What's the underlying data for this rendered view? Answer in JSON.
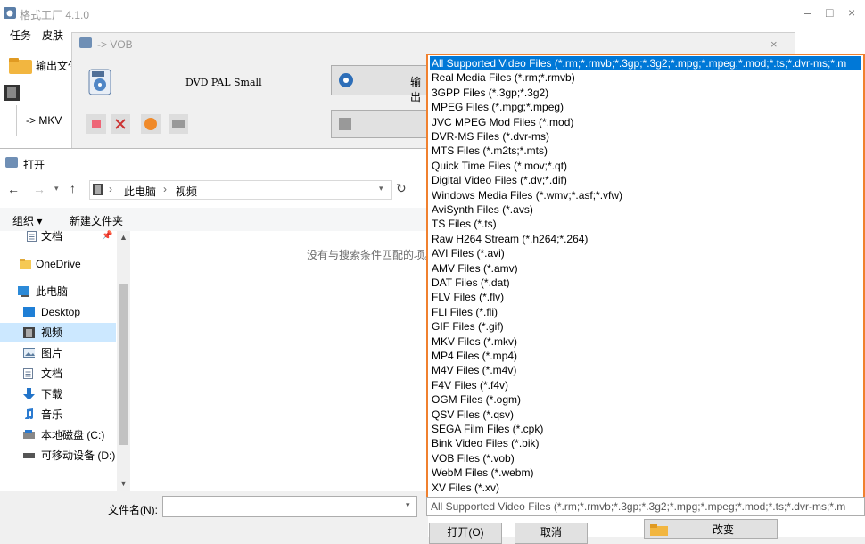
{
  "app": {
    "title": "格式工厂 4.1.0",
    "menu": [
      "任务",
      "皮肤"
    ],
    "output_folder": "输出文件夹",
    "task_item": "-> MKV",
    "controls": {
      "minimize": "–",
      "maximize": "□",
      "close": "×"
    }
  },
  "vob_dialog": {
    "title": "-> VOB",
    "preset": "DVD PAL Small",
    "output_button": "输出",
    "close": "×"
  },
  "open_dialog": {
    "title": "打开",
    "breadcrumb": [
      "此电脑",
      "视频"
    ],
    "organize": "组织 ▾",
    "new_folder": "新建文件夹",
    "tree": [
      {
        "label": "文档",
        "icon": "document-icon"
      },
      {
        "label": "OneDrive",
        "icon": "folder-icon"
      },
      {
        "label": "此电脑",
        "icon": "computer-icon"
      },
      {
        "label": "Desktop",
        "icon": "desktop-icon"
      },
      {
        "label": "视频",
        "icon": "video-icon",
        "selected": true
      },
      {
        "label": "图片",
        "icon": "picture-icon"
      },
      {
        "label": "文档",
        "icon": "document-icon"
      },
      {
        "label": "下载",
        "icon": "download-icon"
      },
      {
        "label": "音乐",
        "icon": "music-icon"
      },
      {
        "label": "本地磁盘 (C:)",
        "icon": "drive-icon"
      },
      {
        "label": "可移动设备 (D:)",
        "icon": "removable-drive-icon"
      }
    ],
    "empty_message": "没有与搜索条件匹配的项。",
    "filename_label": "文件名(N):",
    "filename_value": "",
    "open_button": "打开(O)",
    "cancel_button": "取消",
    "change_button": "改变"
  },
  "file_types": {
    "selected": "All Supported Video Files (*.rm;*.rmvb;*.3gp;*.3g2;*.mpg;*.mpeg;*.mod;*.ts;*.dvr-ms;*.m",
    "options": [
      "All Supported Video Files (*.rm;*.rmvb;*.3gp;*.3g2;*.mpg;*.mpeg;*.mod;*.ts;*.dvr-ms;*.m",
      "Real Media Files (*.rm;*.rmvb)",
      "3GPP Files (*.3gp;*.3g2)",
      "MPEG Files (*.mpg;*.mpeg)",
      "JVC MPEG Mod Files (*.mod)",
      "DVR-MS Files (*.dvr-ms)",
      "MTS Files (*.m2ts;*.mts)",
      "Quick Time Files (*.mov;*.qt)",
      "Digital Video Files (*.dv;*.dif)",
      "Windows Media Files (*.wmv;*.asf;*.vfw)",
      "AviSynth Files (*.avs)",
      "TS Files (*.ts)",
      "Raw H264 Stream (*.h264;*.264)",
      "AVI Files (*.avi)",
      "AMV Files (*.amv)",
      "DAT Files (*.dat)",
      "FLV Files (*.flv)",
      "FLI Files (*.fli)",
      "GIF Files (*.gif)",
      "MKV Files (*.mkv)",
      "MP4 Files (*.mp4)",
      "M4V Files (*.m4v)",
      "F4V Files (*.f4v)",
      "OGM Files (*.ogm)",
      "QSV Files (*.qsv)",
      "SEGA Film Files (*.cpk)",
      "Bink Video Files (*.bik)",
      "VOB Files (*.vob)",
      "WebM Files (*.webm)",
      "XV Files (*.xv)"
    ]
  },
  "colors": {
    "accent": "#0078d7",
    "highlight_border": "#f0812f"
  }
}
